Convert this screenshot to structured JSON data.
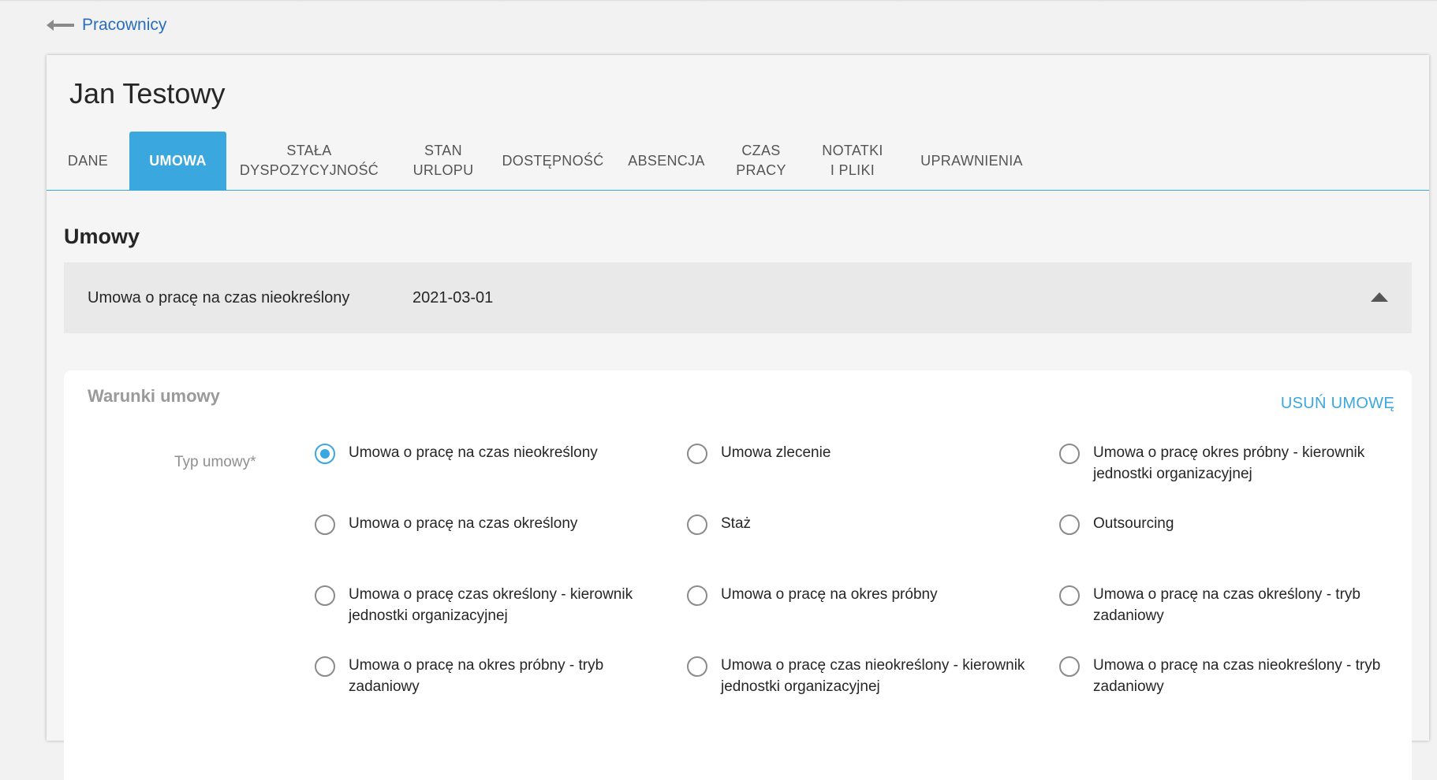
{
  "back_link": {
    "label": "Pracownicy"
  },
  "employee": {
    "name": "Jan Testowy"
  },
  "tabs": [
    {
      "label": "DANE",
      "active": false
    },
    {
      "label": "UMOWA",
      "active": true
    },
    {
      "label": "STAŁA\nDYSPOZYCYJNOŚĆ",
      "active": false
    },
    {
      "label": "STAN\nURLOPU",
      "active": false
    },
    {
      "label": "DOSTĘPNOŚĆ",
      "active": false
    },
    {
      "label": "ABSENCJA",
      "active": false
    },
    {
      "label": "CZAS\nPRACY",
      "active": false
    },
    {
      "label": "NOTATKI\nI PLIKI",
      "active": false
    },
    {
      "label": "UPRAWNIENIA",
      "active": false
    }
  ],
  "contracts": {
    "title": "Umowy",
    "current": {
      "name": "Umowa o pracę na czas nieokreślony",
      "date": "2021-03-01",
      "expanded": true
    }
  },
  "terms": {
    "title": "Warunki umowy",
    "delete_label": "USUŃ UMOWĘ",
    "contract_type_label": "Typ umowy*",
    "options": [
      {
        "label": "Umowa o pracę na czas nieokreślony",
        "selected": true
      },
      {
        "label": "Umowa zlecenie",
        "selected": false
      },
      {
        "label": "Umowa o pracę okres próbny - kierownik jednostki organizacyjnej",
        "selected": false
      },
      {
        "label": "Umowa o pracę na czas określony",
        "selected": false
      },
      {
        "label": "Staż",
        "selected": false
      },
      {
        "label": "Outsourcing",
        "selected": false
      },
      {
        "label": "Umowa o pracę czas określony - kierownik jednostki organizacyjnej",
        "selected": false
      },
      {
        "label": "Umowa o pracę na okres próbny",
        "selected": false
      },
      {
        "label": "Umowa o pracę na czas określony - tryb zadaniowy",
        "selected": false
      },
      {
        "label": "Umowa o pracę na okres próbny - tryb zadaniowy",
        "selected": false
      },
      {
        "label": "Umowa o pracę czas nieokreślony - kierownik jednostki organizacyjnej",
        "selected": false
      },
      {
        "label": "Umowa o pracę na czas nieokreślony - tryb zadaniowy",
        "selected": false
      }
    ]
  },
  "colors": {
    "accent": "#3aa7de",
    "link": "#2a6ebb"
  }
}
